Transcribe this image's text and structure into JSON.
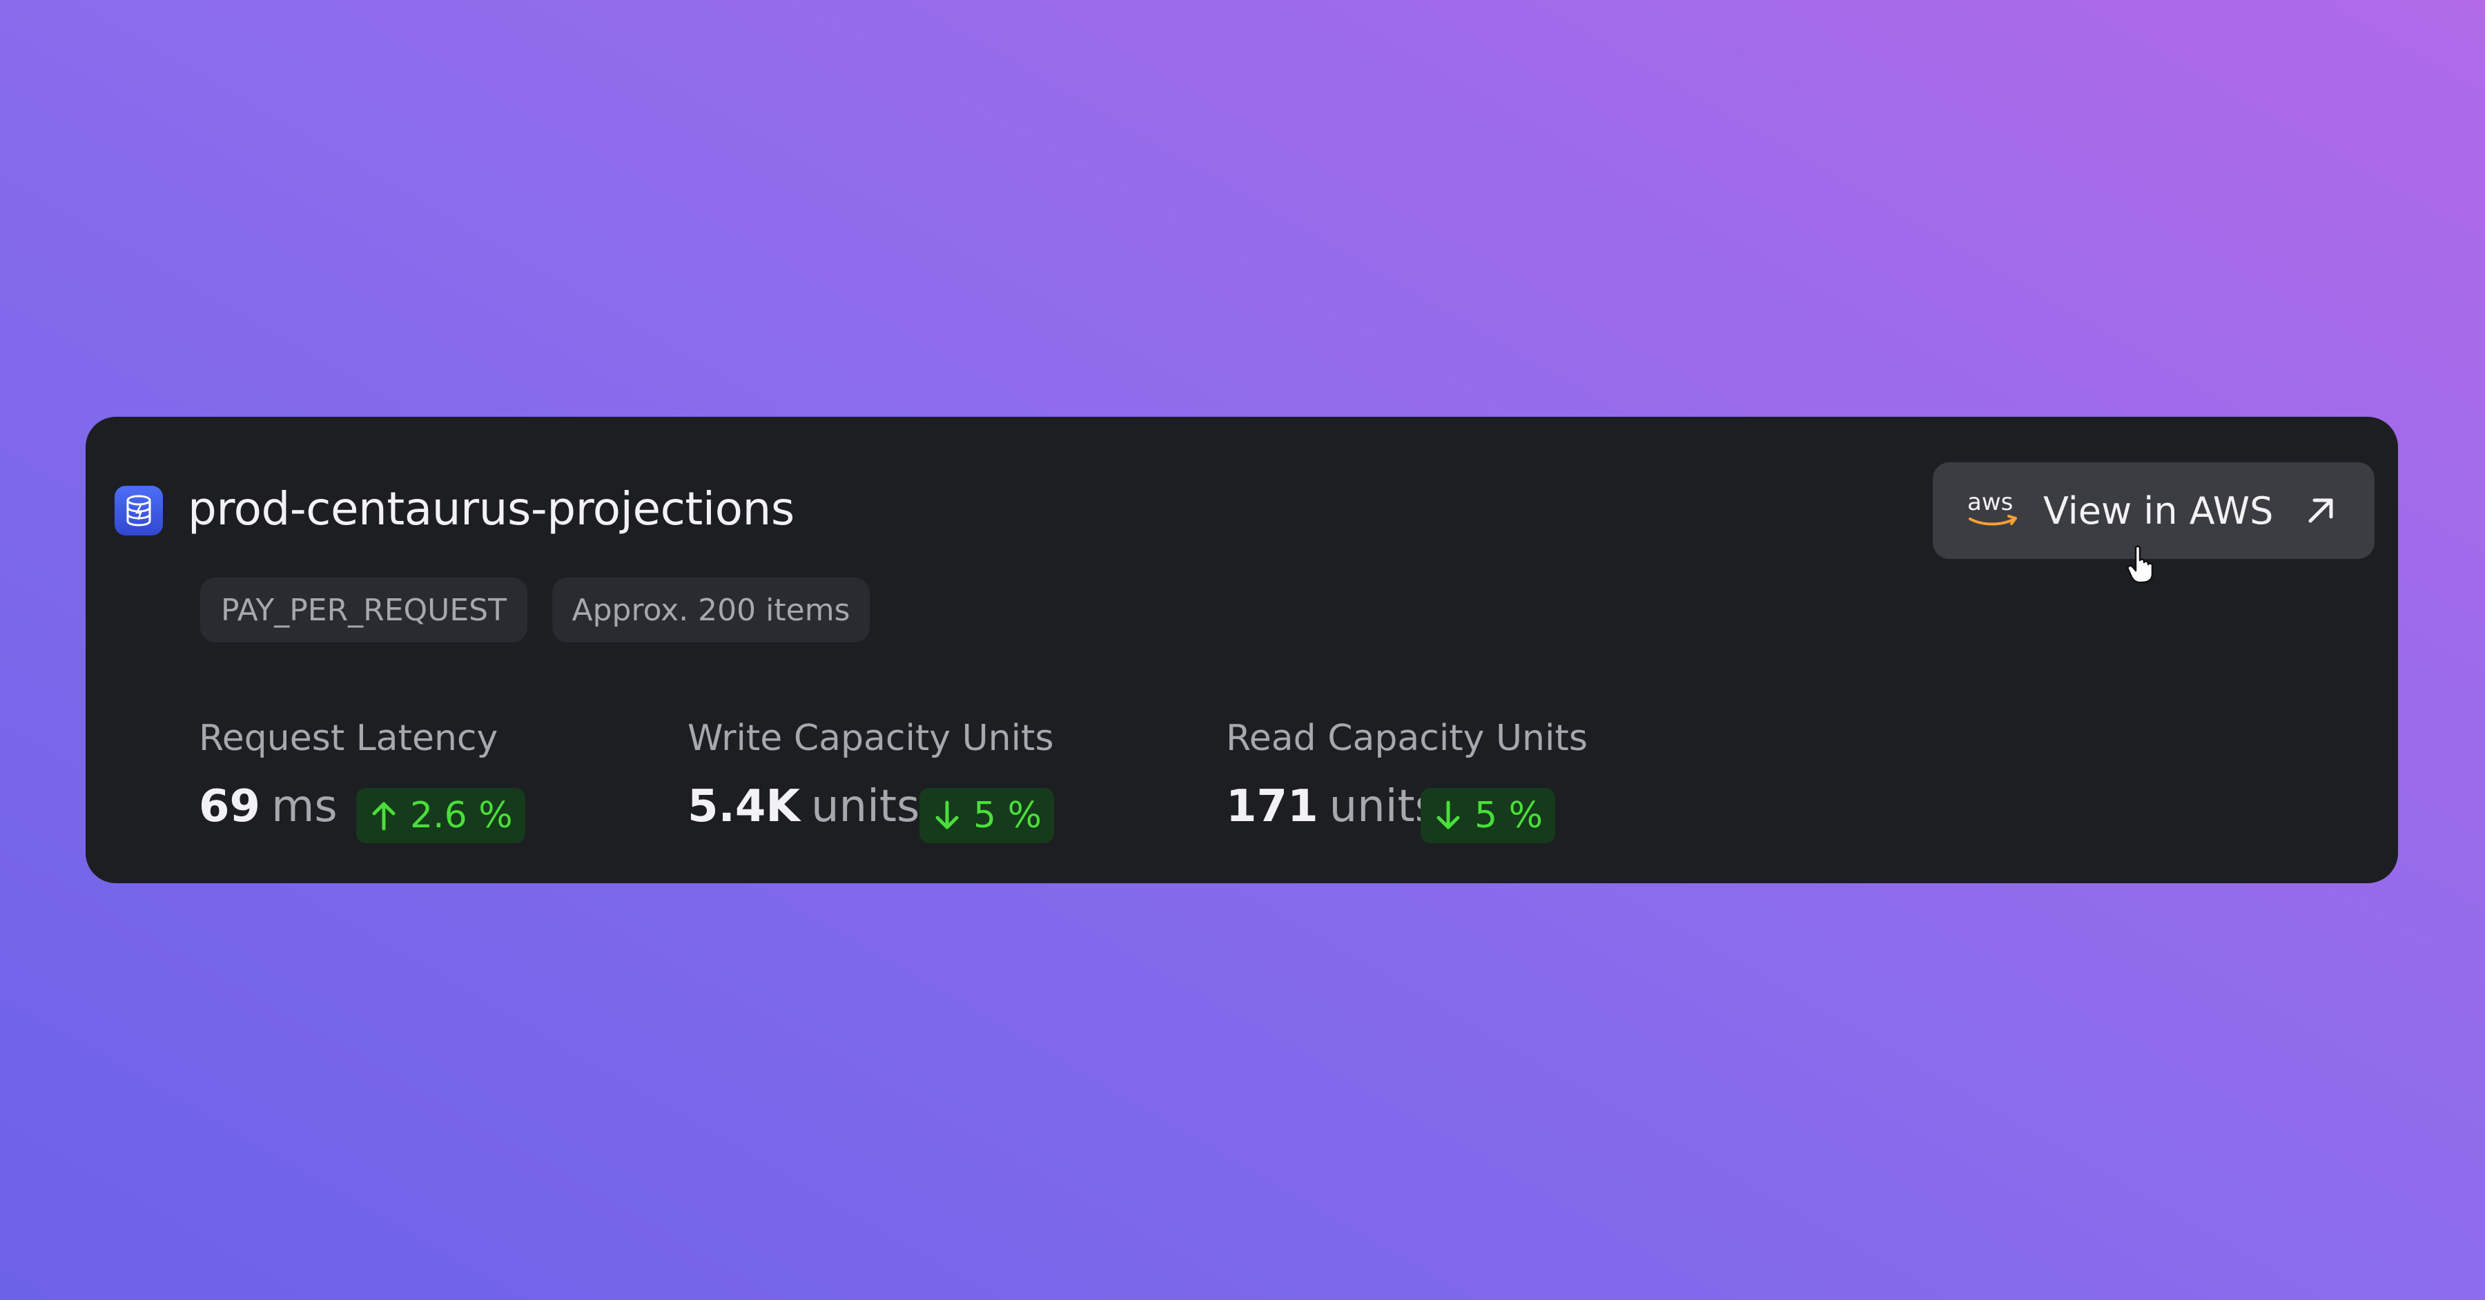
{
  "table": {
    "name": "prod-centaurus-projections",
    "icon": "dynamodb-table-icon",
    "tags": {
      "billing_mode": "PAY_PER_REQUEST",
      "item_count": "Approx. 200 items"
    }
  },
  "actions": {
    "view_in_aws": {
      "logo_text": "aws",
      "label": "View in AWS",
      "icon": "arrow-up-right-icon"
    }
  },
  "metrics": [
    {
      "label": "Request Latency",
      "value": "69",
      "unit": "ms",
      "trend_direction": "up",
      "trend_value": "2.6 %"
    },
    {
      "label": "Write Capacity Units",
      "value": "5.4K",
      "unit": "units",
      "trend_direction": "down",
      "trend_value": "5 %"
    },
    {
      "label": "Read Capacity Units",
      "value": "171",
      "unit": "units",
      "trend_direction": "down",
      "trend_value": "5 %"
    }
  ],
  "colors": {
    "card_background": "#1d1e22",
    "icon_background": "#3f5ff0",
    "button_background": "#3c3d42",
    "trend_background": "#163a1c",
    "trend_text": "#4ade3a",
    "aws_smile": "#f7a035"
  }
}
